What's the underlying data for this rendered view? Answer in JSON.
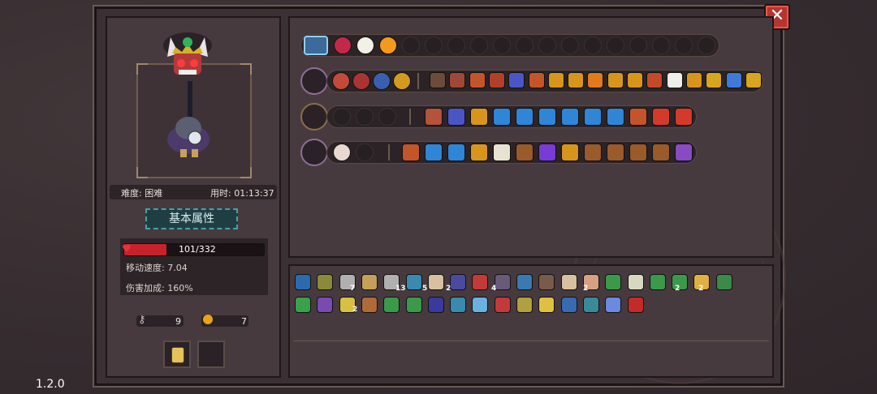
{
  "version": "1.2.0",
  "close_label": "✕",
  "difficulty_label": "难度: 困难",
  "time_label": "用时: 01:13:37",
  "section_title": "基本属性",
  "hp": {
    "current": 101,
    "max": 332,
    "text": "101/332"
  },
  "move_speed": "移动速度: 7.04",
  "damage_bonus": "伤害加成: 160%",
  "keys": "9",
  "coins": "7",
  "colors": {
    "frame": "#3b3034",
    "panel": "#473a3f",
    "hp": "#c7222a",
    "accent": "#4aa0a6"
  },
  "counts": {
    "c1": "7",
    "c2": "13",
    "c3": "5",
    "c4": "2",
    "c5": "4",
    "c6": "2",
    "c7": "2",
    "c8": "2",
    "c9": "2"
  }
}
